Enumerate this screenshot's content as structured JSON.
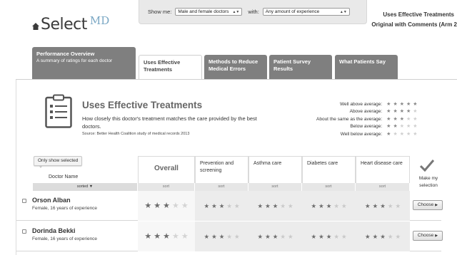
{
  "logo": {
    "brand": "Select",
    "suffix": "MD"
  },
  "filters": {
    "show_me_label": "Show me:",
    "show_me_value": "Male and female doctors",
    "with_label": "with:",
    "with_value": "Any amount of experience"
  },
  "top_right": {
    "line1": "Uses Effective Treatments",
    "line2": "Original with Comments (Arm 2"
  },
  "tabs": [
    {
      "title": "Performance Overview",
      "subtitle": "A summary of ratings for each doctor",
      "active": false
    },
    {
      "title": "Uses Effective Treatments",
      "active": true
    },
    {
      "title": "Methods to Reduce Medical Errors",
      "active": false
    },
    {
      "title": "Patient Survey Results",
      "active": false
    },
    {
      "title": "What Patients Say",
      "active": false
    }
  ],
  "section": {
    "title": "Uses Effective Treatments",
    "description": "How closely this doctor's treatment matches the care provided by the best doctors.",
    "source": "Source: Better Health Coalition study of medical records 2013"
  },
  "legend": [
    {
      "label": "Well above average:",
      "stars": 5
    },
    {
      "label": "Above average:",
      "stars": 4
    },
    {
      "label": "About the same as the average:",
      "stars": 3
    },
    {
      "label": "Below average:",
      "stars": 2
    },
    {
      "label": "Well below average:",
      "stars": 1
    }
  ],
  "table": {
    "show_selected_label": "Only show selected",
    "doctor_name_header": "Doctor Name",
    "columns": {
      "overall": "Overall",
      "prevention": "Prevention and screening",
      "asthma": "Asthma care",
      "diabetes": "Diabetes care",
      "heart": "Heart disease care"
    },
    "my_selection_label": "Make my selection",
    "sorted_label": "sorted",
    "sort_label": "sort",
    "choose_label": "Choose",
    "rows": [
      {
        "name": "Orson Alban",
        "info": "Female, 16 years of experience",
        "overall": 3,
        "prevention": 3,
        "asthma": 3,
        "diabetes": 3,
        "heart": 3
      },
      {
        "name": "Dorinda Bekki",
        "info": "Female, 16 years of experience",
        "overall": 3,
        "prevention": 3,
        "asthma": 3,
        "diabetes": 3,
        "heart": 3
      }
    ]
  },
  "colors": {
    "tab_inactive": "#7f7f7f",
    "accent": "#7aa7c4",
    "star_on": "#6d6d6d",
    "star_off": "#d4d4d4"
  }
}
